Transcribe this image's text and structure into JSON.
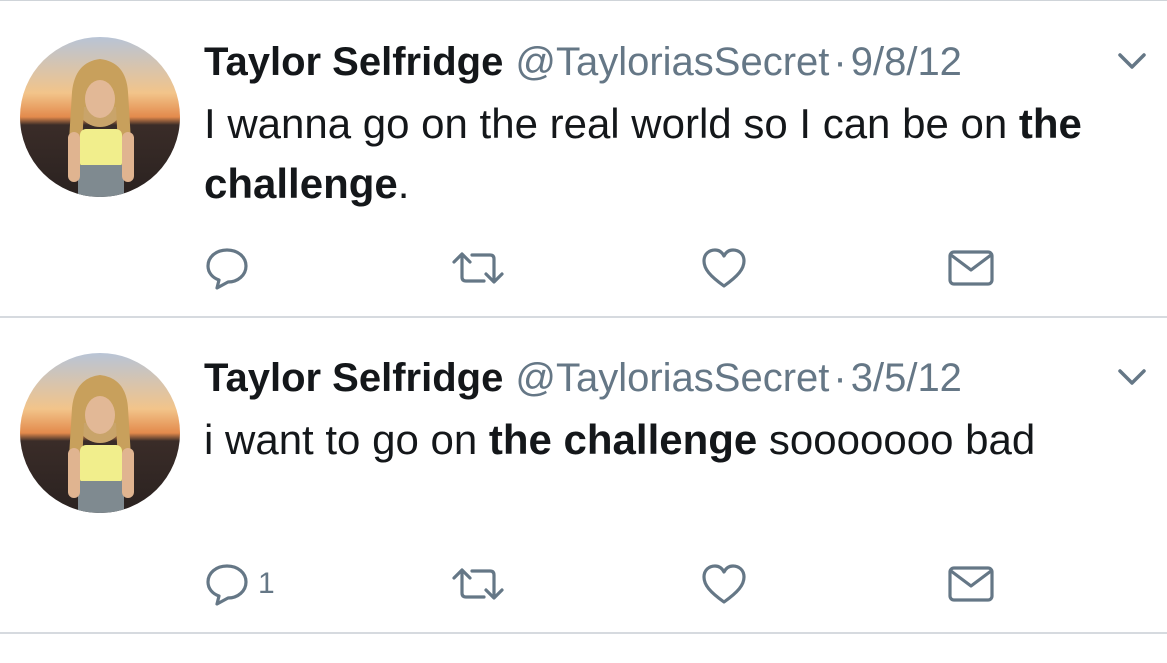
{
  "tweets": [
    {
      "name": "Taylor Selfridge",
      "handle": "@TayloriasSecret",
      "separator": "·",
      "date": "9/8/12",
      "text_parts": {
        "p1": "I wanna go on the real world so I can be on ",
        "p2_bold": "the challenge",
        "p3": "."
      },
      "reply_count": "",
      "avatar_icon": "profile-photo",
      "menu_icon": "chevron-down-icon"
    },
    {
      "name": "Taylor Selfridge",
      "handle": "@TayloriasSecret",
      "separator": "·",
      "date": "3/5/12",
      "text_parts": {
        "p1": "i want to go on ",
        "p2_bold": "the challenge",
        "p3": " sooooooo bad"
      },
      "reply_count": "1",
      "avatar_icon": "profile-photo",
      "menu_icon": "chevron-down-icon"
    }
  ],
  "icons": {
    "reply": "reply-icon",
    "retweet": "retweet-icon",
    "like": "heart-icon",
    "dm": "mail-icon"
  },
  "colors": {
    "text": "#14171a",
    "secondary": "#657786",
    "divider": "#d6dadf"
  }
}
